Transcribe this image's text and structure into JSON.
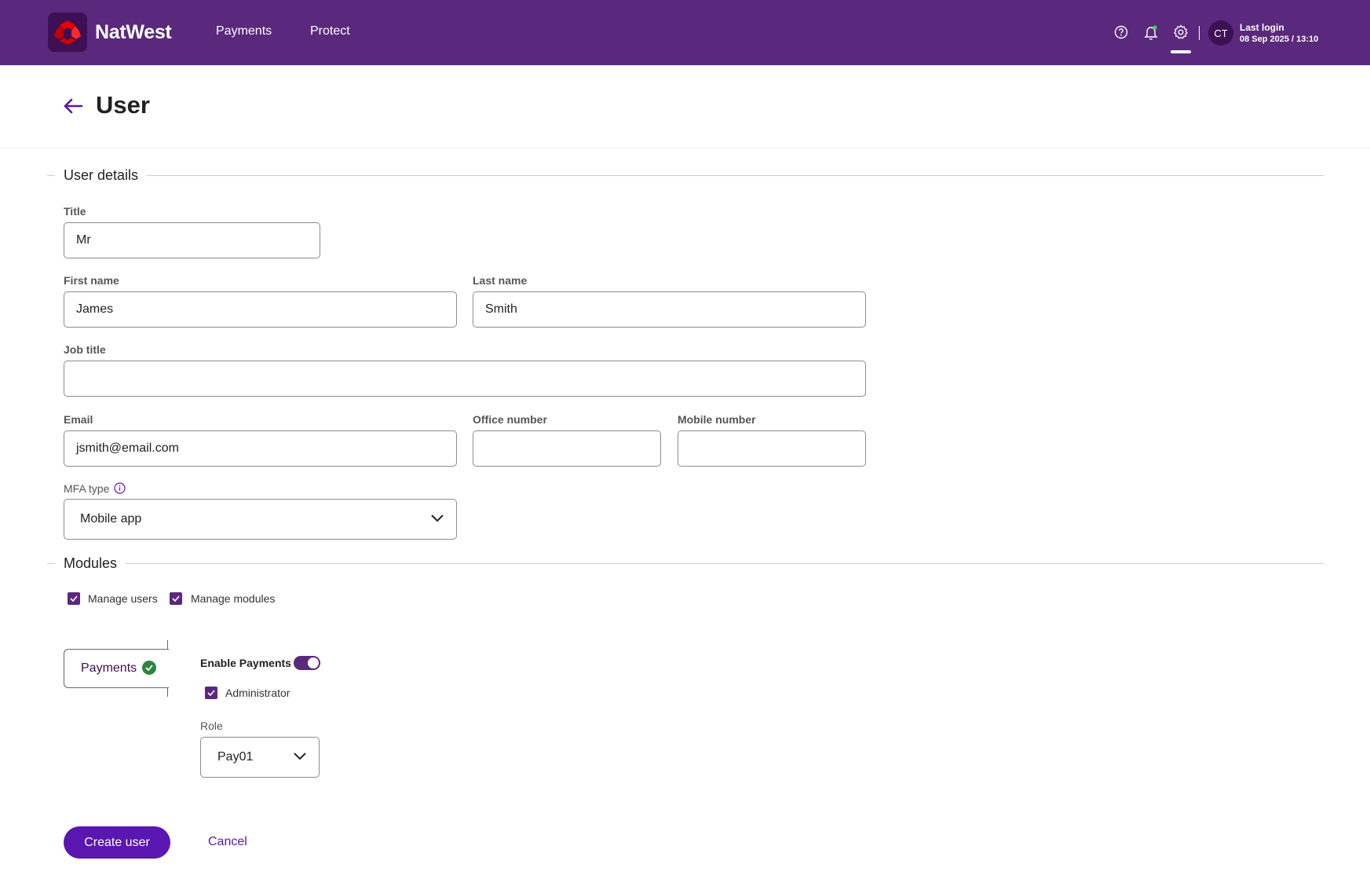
{
  "header": {
    "brand": "NatWest",
    "nav": [
      "Payments",
      "Protect"
    ],
    "avatar_initials": "CT",
    "last_login_label": "Last login",
    "last_login_value": "08 Sep 2025 / 13:10",
    "icons": [
      "help-icon",
      "bell-icon",
      "gear-icon"
    ],
    "active_icon": "gear-icon"
  },
  "page": {
    "title": "User"
  },
  "user_details": {
    "section_title": "User details",
    "title_label": "Title",
    "title_value": "Mr",
    "first_name_label": "First name",
    "first_name_value": "James",
    "last_name_label": "Last name",
    "last_name_value": "Smith",
    "job_title_label": "Job title",
    "job_title_value": "",
    "email_label": "Email",
    "email_value": "jsmith@email.com",
    "office_label": "Office number",
    "office_value": "",
    "mobile_label": "Mobile number",
    "mobile_value": "",
    "mfa_label": "MFA type",
    "mfa_value": "Mobile app"
  },
  "modules": {
    "section_title": "Modules",
    "checkboxes": [
      {
        "label": "Manage users",
        "checked": true
      },
      {
        "label": "Manage modules",
        "checked": true
      }
    ],
    "payments_tab_label": "Payments",
    "enable_label": "Enable Payments",
    "enable_on": true,
    "administrator_label": "Administrator",
    "administrator_checked": true,
    "role_label": "Role",
    "role_value": "Pay01"
  },
  "actions": {
    "create_label": "Create user",
    "cancel_label": "Cancel"
  },
  "colors": {
    "header_bg": "#5a287d",
    "primary_button": "#5a16b0",
    "success": "#2e8540",
    "logo_red": "#e90000"
  }
}
